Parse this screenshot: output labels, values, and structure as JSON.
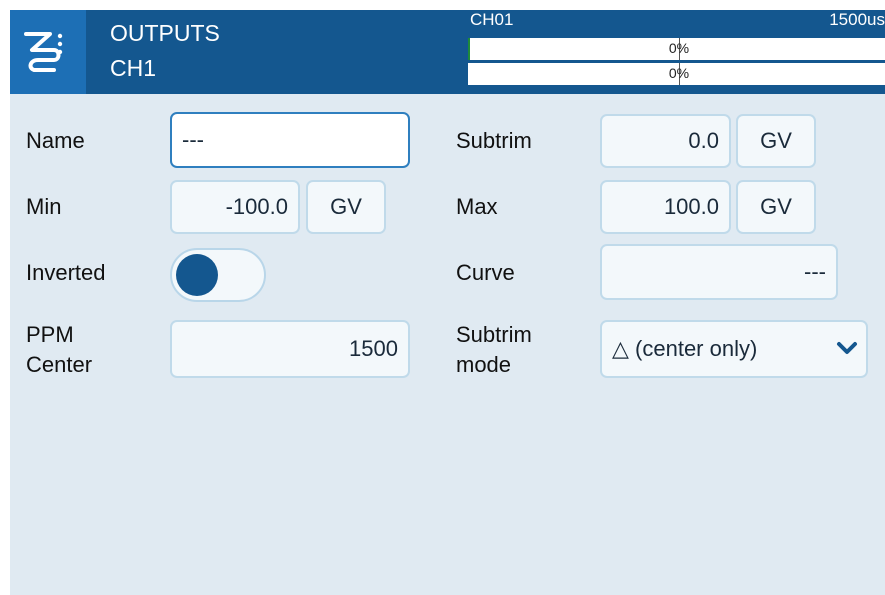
{
  "header": {
    "title": "OUTPUTS",
    "subtitle": "CH1",
    "channel_name": "CH01",
    "channel_value": "1500us",
    "bars": [
      {
        "percent_label": "0%",
        "fill_fraction": 0.0
      },
      {
        "percent_label": "0%",
        "fill_fraction": 0.0
      }
    ]
  },
  "form": {
    "name_label": "Name",
    "name_value": "---",
    "subtrim_label": "Subtrim",
    "subtrim_value": "0.0",
    "subtrim_gv": "GV",
    "min_label": "Min",
    "min_value": "-100.0",
    "min_gv": "GV",
    "max_label": "Max",
    "max_value": "100.0",
    "max_gv": "GV",
    "inverted_label": "Inverted",
    "inverted_on": false,
    "curve_label": "Curve",
    "curve_value": "---",
    "ppm_label_line1": "PPM",
    "ppm_label_line2": "Center",
    "ppm_value": "1500",
    "subtrim_mode_label_line1": "Subtrim",
    "subtrim_mode_label_line2": "mode",
    "subtrim_mode_value": "△ (center only)"
  },
  "icons": {
    "app_logo": "outputs-icon",
    "dropdown": "chevron-down-icon"
  },
  "colors": {
    "header_bg": "#14578f",
    "logo_bg": "#1d6fb5",
    "screen_bg": "#e0eaf2",
    "focus_border": "#2f7fbf"
  }
}
